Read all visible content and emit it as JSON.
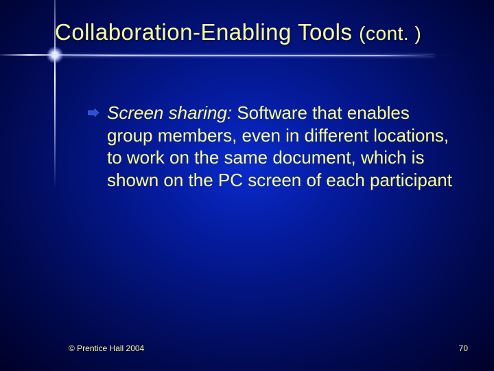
{
  "title": {
    "main": "Collaboration-Enabling Tools ",
    "cont": "(cont. )"
  },
  "bullet": {
    "term": "Screen sharing:",
    "definition": " Software that enables group members, even in different locations, to work on the same document, which is shown on the PC screen of each participant"
  },
  "footer": {
    "copyright": "© Prentice Hall 2004",
    "page": "70"
  }
}
